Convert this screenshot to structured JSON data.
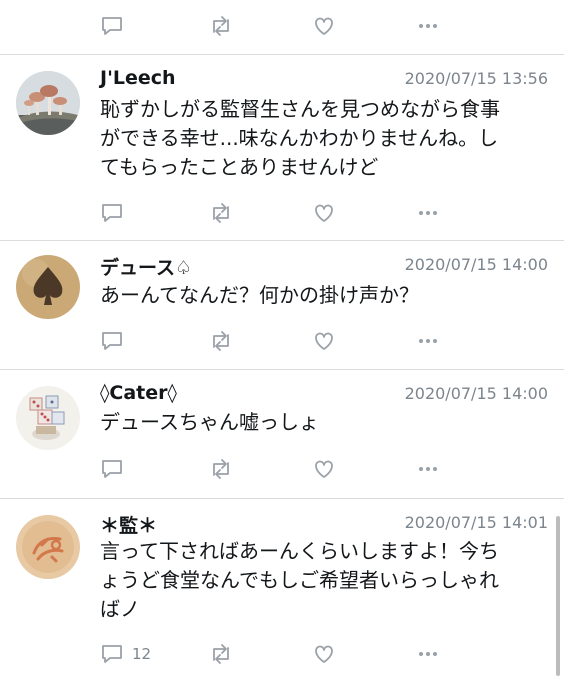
{
  "tweets": [
    {
      "name": "J'Leech",
      "time": "2020/07/15 13:56",
      "lines": [
        "恥ずかしがる監督生さんを見つめながら食事",
        "ができる幸せ...味なんかわかりませんね。し",
        "てもらったことありませんけど"
      ],
      "avatar_icon": "mushroom-avatar",
      "reply_count": ""
    },
    {
      "name": "デュース♤",
      "time": "2020/07/15 14:00",
      "lines": [
        "あーんてなんだ？何かの掛け声か？"
      ],
      "avatar_icon": "spade-avatar",
      "reply_count": ""
    },
    {
      "name": "◊Cater◊",
      "time": "2020/07/15 14:00",
      "lines": [
        "デュースちゃん嘘っしょ"
      ],
      "avatar_icon": "dice-avatar",
      "reply_count": ""
    },
    {
      "name": "＊監＊",
      "time": "2020/07/15 14:01",
      "lines": [
        "言って下さればあーんくらいしますよ！今ち",
        "ょうど食堂なんでもしご希望者いらっしゃれ",
        "ばノ"
      ],
      "avatar_icon": "stamp-avatar",
      "reply_count": "12"
    }
  ],
  "colors": {
    "icon_gray": "#9aa1a8",
    "text_gray": "#7c858d",
    "divider": "#d9dde0"
  }
}
